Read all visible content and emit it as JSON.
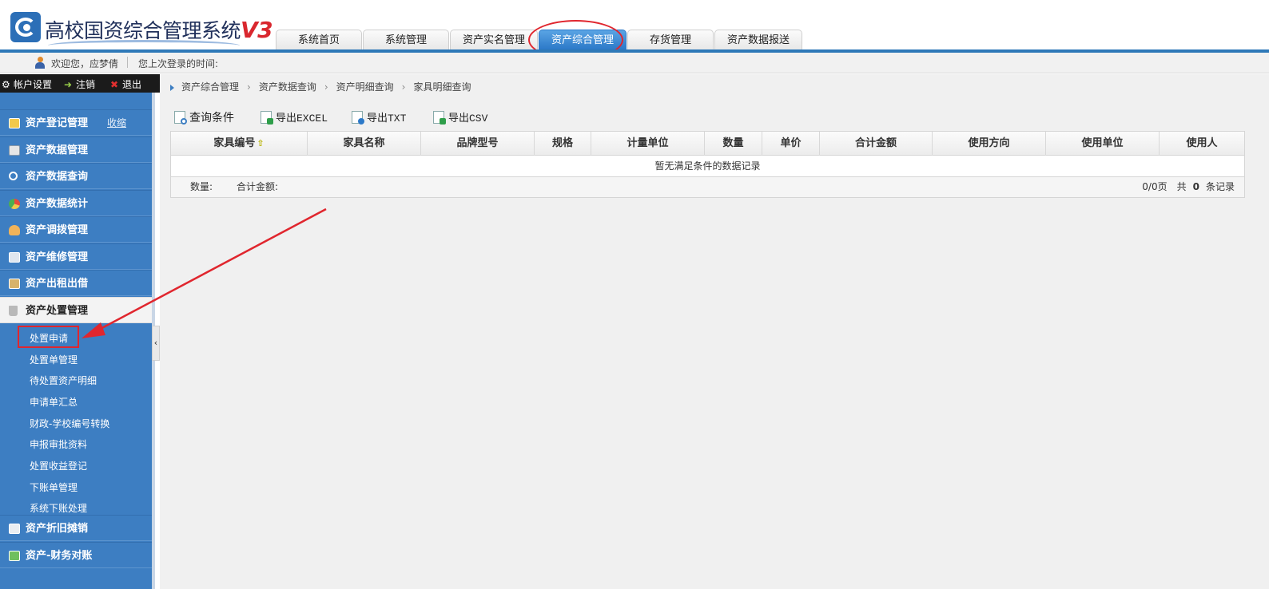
{
  "header": {
    "system_name": "高校国资综合管理系统",
    "version": "V3",
    "tabs": [
      {
        "label": "系统首页",
        "active": false
      },
      {
        "label": "系统管理",
        "active": false
      },
      {
        "label": "资产实名管理",
        "active": false
      },
      {
        "label": "资产综合管理",
        "active": true
      },
      {
        "label": "存货管理",
        "active": false
      },
      {
        "label": "资产数据报送",
        "active": false
      }
    ]
  },
  "welcome": {
    "greeting": "欢迎您，应梦倩",
    "last_login": "您上次登录的时间:"
  },
  "account_bar": {
    "settings": "帐户设置",
    "logout": "注销",
    "exit": "退出"
  },
  "sidebar": {
    "collapse_label": "收缩",
    "menus": [
      {
        "label": "资产登记管理",
        "icon": "register-icon"
      },
      {
        "label": "资产数据管理",
        "icon": "data-icon"
      },
      {
        "label": "资产数据查询",
        "icon": "search-icon"
      },
      {
        "label": "资产数据统计",
        "icon": "stats-icon"
      },
      {
        "label": "资产调拨管理",
        "icon": "users-icon"
      },
      {
        "label": "资产维修管理",
        "icon": "repair-icon"
      },
      {
        "label": "资产出租出借",
        "icon": "lease-icon"
      },
      {
        "label": "资产处置管理",
        "icon": "trash-icon"
      },
      {
        "label": "资产折旧摊销",
        "icon": "depreciation-icon"
      },
      {
        "label": "资产-财务对账",
        "icon": "finance-icon"
      }
    ],
    "submenu": [
      "处置申请",
      "处置单管理",
      "待处置资产明细",
      "申请单汇总",
      "财政-学校编号转换",
      "申报审批资料",
      "处置收益登记",
      "下账单管理",
      "系统下账处理"
    ]
  },
  "breadcrumb": [
    "资产综合管理",
    "资产数据查询",
    "资产明细查询",
    "家具明细查询"
  ],
  "toolbar": {
    "query": "查询条件",
    "export_excel": "导出EXCEL",
    "export_txt": "导出TXT",
    "export_csv": "导出CSV"
  },
  "grid": {
    "columns": [
      "家具编号",
      "家具名称",
      "品牌型号",
      "规格",
      "计量单位",
      "数量",
      "单价",
      "合计金额",
      "使用方向",
      "使用单位",
      "使用人"
    ],
    "empty_message": "暂无满足条件的数据记录",
    "footer": {
      "qty_label": "数量:",
      "total_label": "合计金额:",
      "pages": "0/0页",
      "total_prefix": "共",
      "total_count": "0",
      "total_suffix": "条记录"
    }
  },
  "colors": {
    "accent": "#3d7ec2",
    "annotation_red": "#e0262e",
    "brand_red": "#d9272e"
  }
}
